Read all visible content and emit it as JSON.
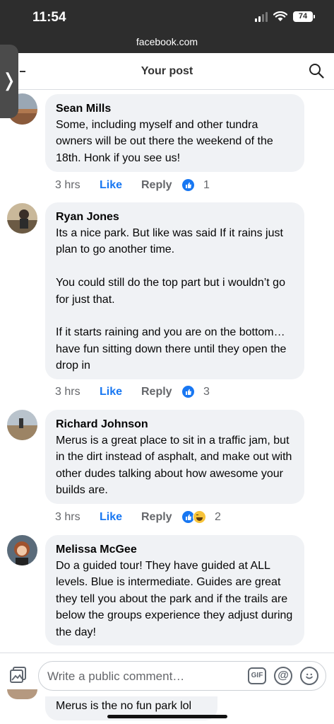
{
  "status_bar": {
    "time": "11:54",
    "battery": "74"
  },
  "browser": {
    "url": "facebook.com"
  },
  "side_tab": {
    "glyph": "❭"
  },
  "header": {
    "title": "Your post"
  },
  "comments": [
    {
      "author": "Sean Mills",
      "text": "Some, including myself and other tundra owners will be out there the weekend of the 18th. Honk if you see us!",
      "time": "3 hrs",
      "like": "Like",
      "reply": "Reply",
      "reactions": [
        "like"
      ],
      "reaction_count": "1"
    },
    {
      "author": "Ryan Jones",
      "text": "Its a nice park. But like was said If it rains just plan to go another time.\n\nYou could still do the top part but i wouldn’t go for just that.\n\nIf it starts raining and you are on the bottom… have fun sitting down there until they open the drop in",
      "time": "3 hrs",
      "like": "Like",
      "reply": "Reply",
      "reactions": [
        "like"
      ],
      "reaction_count": "3"
    },
    {
      "author": "Richard Johnson",
      "text": "Merus is a great place to sit in a traffic jam, but in the dirt instead of asphalt, and make out with other dudes talking about how awesome your builds are.",
      "time": "3 hrs",
      "like": "Like",
      "reply": "Reply",
      "reactions": [
        "like",
        "haha"
      ],
      "reaction_count": "2"
    },
    {
      "author": "Melissa McGee",
      "text": "Do a guided tour! They have guided at ALL levels. Blue is intermediate. Guides are great they tell you about the park and if the trails are below the groups experience they adjust during the day!"
    }
  ],
  "composer": {
    "placeholder": "Write a public comment…",
    "gif_label": "GIF",
    "mention_glyph": "@"
  },
  "partial_comment": {
    "text": "Merus is the no fun park lol"
  },
  "colors": {
    "accent": "#1877f2",
    "bubble": "#f0f2f5",
    "meta": "#65676b",
    "status_bar": "#2d2d2d"
  }
}
